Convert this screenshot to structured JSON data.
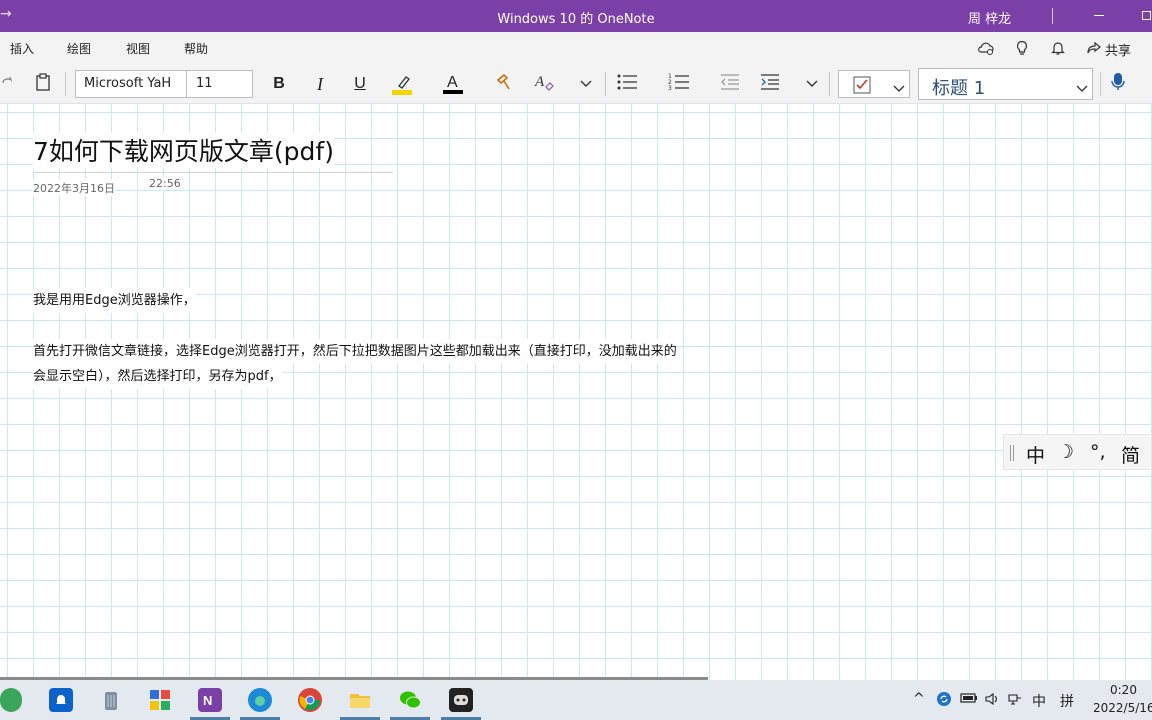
{
  "titlebar": {
    "back_glyph": "→",
    "title": "Windows 10 的 OneNote",
    "user": "周 梓龙"
  },
  "menubar": {
    "items": [
      "插入",
      "绘图",
      "视图",
      "帮助"
    ],
    "share_label": "共享"
  },
  "toolbar": {
    "font_name": "Microsoft YaH",
    "font_size": "11",
    "bold": "B",
    "italic": "I",
    "underline": "U",
    "font_color_letter": "A",
    "style": "标题 1",
    "colors": {
      "highlight": "#f2d400",
      "font_color": "#000000",
      "tag_check": "#c0392b",
      "mic": "#1e5ea8"
    }
  },
  "page": {
    "title": "7如何下载网页版文章(pdf)",
    "date": "2022年3月16日",
    "time": "22:56",
    "paragraphs": [
      "我是用用Edge浏览器操作，",
      "首先打开微信文章链接，选择Edge浏览器打开，然后下拉把数据图片这些都加载出来（直接打印，没加载出来的",
      "会显示空白），然后选择打印，另存为pdf，"
    ]
  },
  "ime": {
    "mode": "中",
    "moon": "☽",
    "punct": "°,",
    "simplified": "简"
  },
  "taskbar": {
    "apps": [
      "edge-green-icon",
      "notification-app-icon",
      "trash-app-icon",
      "mosaic-app-icon",
      "onenote-icon",
      "edge-icon",
      "chrome-icon",
      "file-explorer-icon",
      "wechat-icon",
      "game-app-icon"
    ],
    "tray": {
      "chevron": "^",
      "ime_lang": "中",
      "ime_mode": "拼"
    },
    "clock_time": "0:20",
    "clock_date": "2022/5/16"
  }
}
